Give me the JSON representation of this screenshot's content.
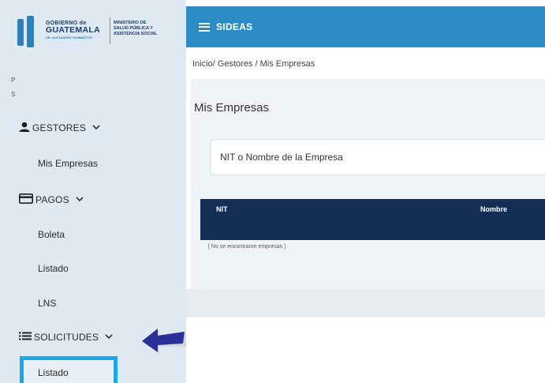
{
  "logo": {
    "line1": "GOBIERNO de",
    "line2": "GUATEMALA",
    "line3": "DR. ALEJANDRO GIAMMATTEI",
    "ministry_l1": "MINISTERIO DE",
    "ministry_l2": "SALUD PÚBLICA Y",
    "ministry_l3": "ASISTENCIA SOCIAL"
  },
  "sidebar": {
    "tiny1": "P",
    "tiny2": "S",
    "sections": [
      {
        "label": "GESTORES",
        "icon": "user-icon",
        "items": [
          "Mis Empresas"
        ]
      },
      {
        "label": "PAGOS",
        "icon": "card-icon",
        "items": [
          "Boleta",
          "Listado",
          "LNS"
        ]
      },
      {
        "label": "SOLICITUDES",
        "icon": "list-icon",
        "items": [
          "Listado"
        ]
      }
    ]
  },
  "topbar": {
    "brand": "SIDEAS"
  },
  "content": {
    "breadcrumb": "Inicio/ Gestores / Mis Empresas",
    "title": "Mis Empresas",
    "search_placeholder": "NIT o Nombre de la Empresa",
    "table": {
      "columns": [
        "NIT",
        "Nombre"
      ],
      "empty_text": "[ No se encontraron empresas ]"
    }
  },
  "colors": {
    "sidebar_bg": "#dfe9f1",
    "topbar_bg": "#2b8cc4",
    "table_header_bg": "#142e55",
    "highlight": "#1aa6e8",
    "arrow": "#2b2f9a"
  }
}
